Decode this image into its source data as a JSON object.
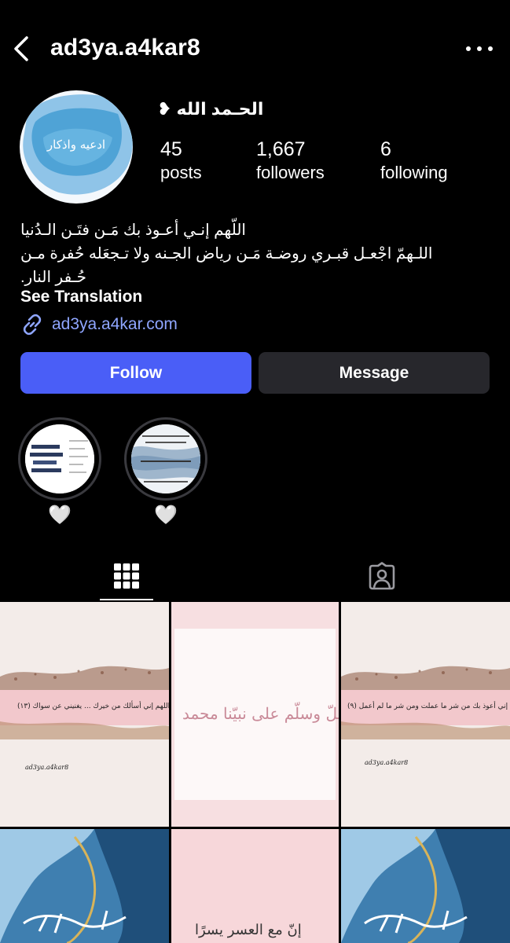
{
  "header": {
    "username": "ad3ya.a4kar8"
  },
  "profile": {
    "display_name": "الحـمد الله ❥",
    "avatar_text": "ادعيه واذكار",
    "stats": {
      "posts": {
        "value": "45",
        "label": "posts"
      },
      "followers": {
        "value": "1,667",
        "label": "followers"
      },
      "following": {
        "value": "6",
        "label": "following"
      }
    },
    "bio": {
      "line1": "اللّهم إنـي أعـوذ بك مَـن فتَـن الـدُنيا",
      "line2": "اللـهمّ اجْعـل قبـري روضـة مَـن رياض الجـنه ولا تـجعَله حُفرة مـن",
      "line3": "حُـفر النار."
    },
    "see_translation": "See Translation",
    "link": "ad3ya.a4kar.com"
  },
  "actions": {
    "follow": "Follow",
    "message": "Message"
  },
  "highlights": [
    {
      "label": "🤍"
    },
    {
      "label": "🤍"
    }
  ],
  "posts": {
    "post1_caption": "اللهم إني أسألك من خيرك ... يغنيني عن سواك (١٣)",
    "post1_sign": "ad3ya.a4kar8",
    "post2_text": "اللّهُمّ صلّ وسلّم على نبيّنا محمد",
    "post3_caption": "اللهم إني أعوذ بك من شر ما عملت ومن شر ما لم أعمل (٩)",
    "post3_sign": "ad3ya.a4kar8",
    "post5_text": "إنّ مع العسر يسرًا"
  },
  "colors": {
    "background": "#000000",
    "follow_button": "#4a5ef7",
    "message_button": "#27272c",
    "link": "#8fa6ff"
  }
}
